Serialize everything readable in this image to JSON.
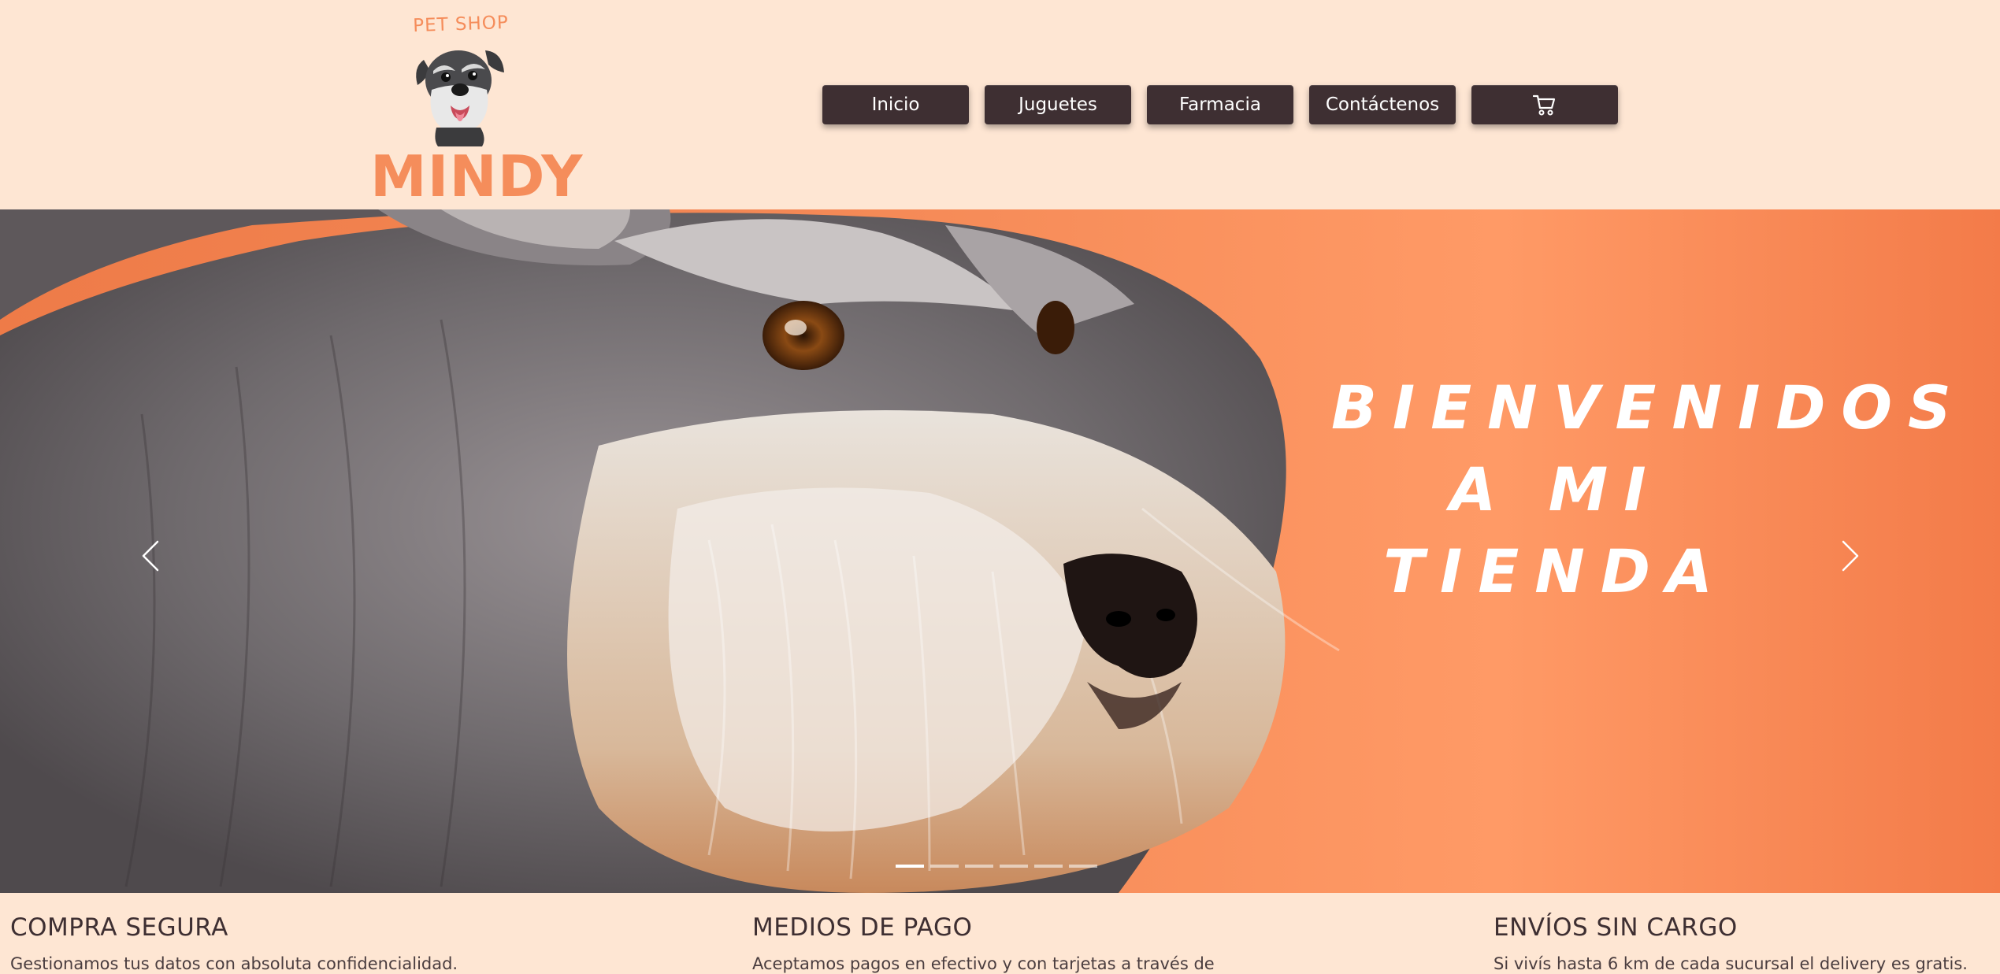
{
  "header": {
    "logo": {
      "tagline": "PET SHOP",
      "brand": "MINDY",
      "icon": "schnauzer-dog-logo"
    },
    "nav": {
      "items": [
        {
          "label": "Inicio"
        },
        {
          "label": "Juguetes"
        },
        {
          "label": "Farmacia"
        },
        {
          "label": "Contáctenos"
        }
      ],
      "cart_icon": "cart-icon"
    }
  },
  "hero": {
    "title_line1": "BIENVENIDOS",
    "title_line2": "A MI TIENDA",
    "image": "schnauzer-closeup-photo",
    "prev_icon": "chevron-left-icon",
    "next_icon": "chevron-right-icon",
    "slides_total": 6,
    "active_slide": 1
  },
  "features": [
    {
      "title": "COMPRA SEGURA",
      "text": "Gestionamos tus datos con absoluta confidencialidad."
    },
    {
      "title": "MEDIOS DE PAGO",
      "text": "Aceptamos pagos en efectivo y con tarjetas a través de"
    },
    {
      "title": "ENVÍOS SIN CARGO",
      "text": "Si vivís hasta 6 km de cada sucursal el delivery es gratis."
    }
  ],
  "colors": {
    "background": "#fee6d3",
    "accent": "#f58d5b",
    "nav_button": "#3e2f32",
    "hero_orange": "#f58a57"
  }
}
